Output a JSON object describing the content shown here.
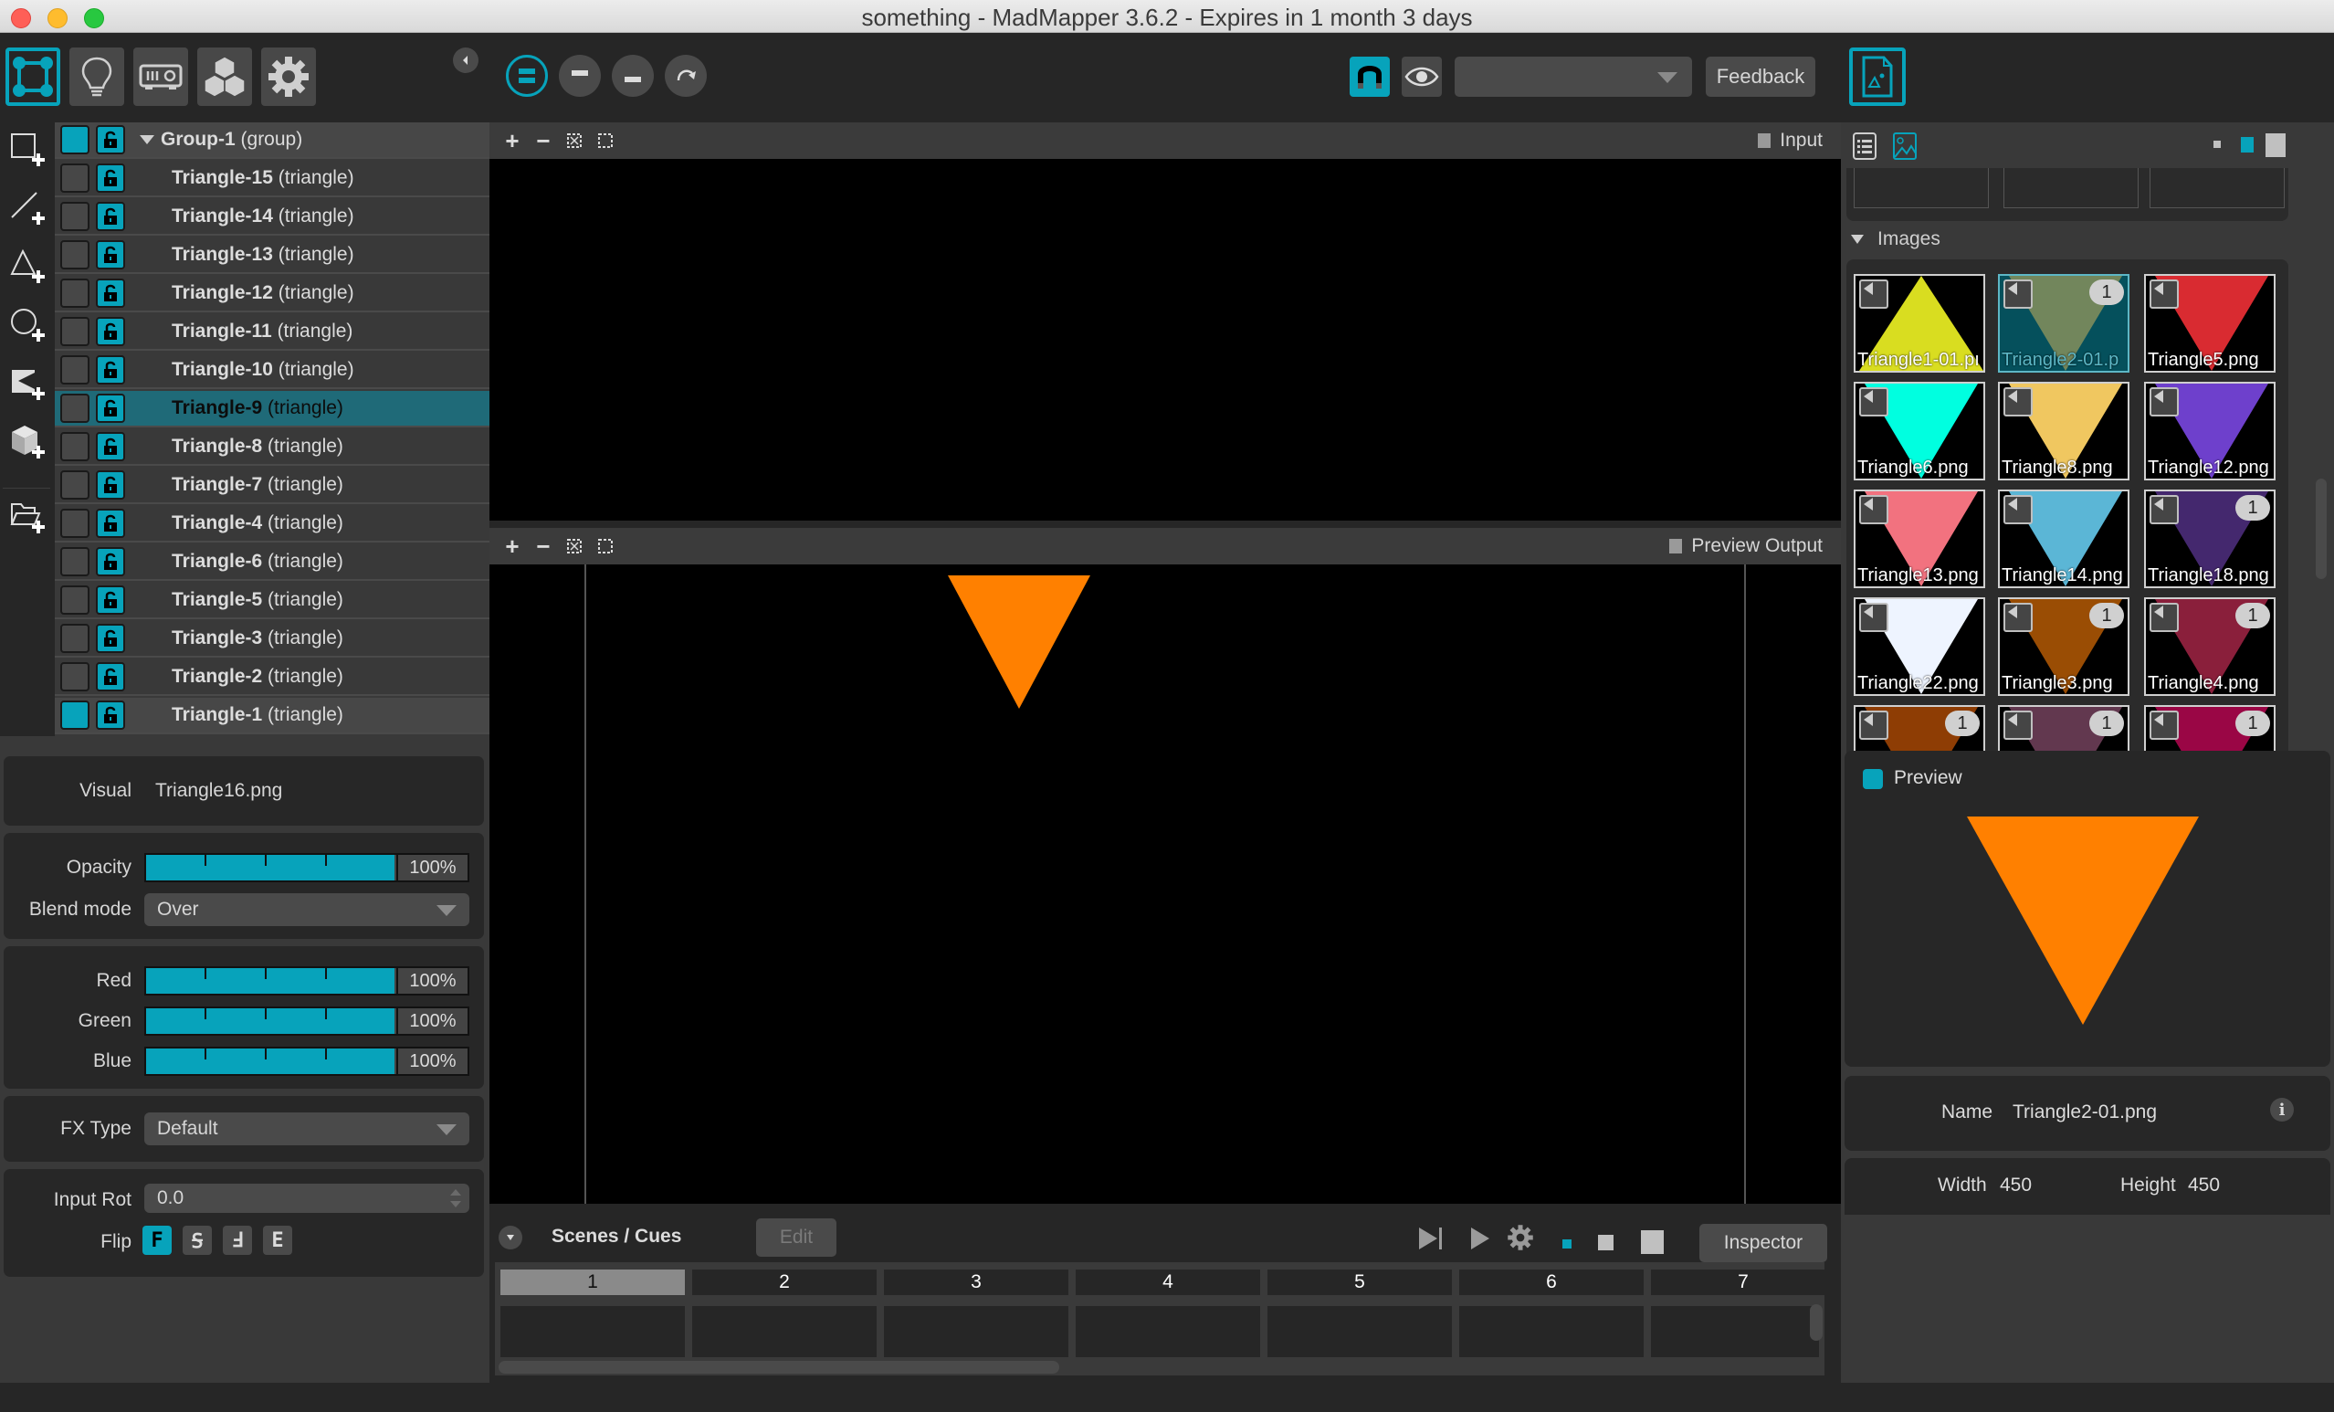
{
  "window": {
    "title": "something - MadMapper 3.6.2 - Expires in 1 month 3 days"
  },
  "colors": {
    "accent": "#07a3bb",
    "orange": "#ff8000",
    "selection_row": "#1f6a78"
  },
  "toolbar": {
    "modes": [
      {
        "name": "surfaces-mode",
        "icon": "surface-icon",
        "active": true
      },
      {
        "name": "lights-mode",
        "icon": "lightbulb-icon",
        "active": false
      },
      {
        "name": "output-mode",
        "icon": "projector-icon",
        "active": false
      },
      {
        "name": "modules-mode",
        "icon": "cubes-icon",
        "active": false
      },
      {
        "name": "settings-mode",
        "icon": "gear-icon",
        "active": false
      }
    ],
    "view_buttons": [
      "split-view",
      "top-view",
      "bottom-view",
      "rotate-view"
    ],
    "snap_label": "magnet-icon",
    "visibility_label": "eye-icon",
    "dropdown_value": "",
    "feedback_label": "Feedback"
  },
  "tools": [
    "add-quad",
    "add-line",
    "add-triangle",
    "add-circle",
    "add-mask",
    "add-3d-object",
    "add-group"
  ],
  "layers": {
    "group": {
      "name": "Group-1",
      "kind": "(group)",
      "visible": true
    },
    "items": [
      {
        "name": "Triangle-15",
        "kind": "(triangle)",
        "visible": false,
        "selected": false
      },
      {
        "name": "Triangle-14",
        "kind": "(triangle)",
        "visible": false,
        "selected": false
      },
      {
        "name": "Triangle-13",
        "kind": "(triangle)",
        "visible": false,
        "selected": false
      },
      {
        "name": "Triangle-12",
        "kind": "(triangle)",
        "visible": false,
        "selected": false
      },
      {
        "name": "Triangle-11",
        "kind": "(triangle)",
        "visible": false,
        "selected": false
      },
      {
        "name": "Triangle-10",
        "kind": "(triangle)",
        "visible": false,
        "selected": false
      },
      {
        "name": "Triangle-9",
        "kind": "(triangle)",
        "visible": false,
        "selected": true
      },
      {
        "name": "Triangle-8",
        "kind": "(triangle)",
        "visible": false,
        "selected": false
      },
      {
        "name": "Triangle-7",
        "kind": "(triangle)",
        "visible": false,
        "selected": false
      },
      {
        "name": "Triangle-4",
        "kind": "(triangle)",
        "visible": false,
        "selected": false
      },
      {
        "name": "Triangle-6",
        "kind": "(triangle)",
        "visible": false,
        "selected": false
      },
      {
        "name": "Triangle-5",
        "kind": "(triangle)",
        "visible": false,
        "selected": false
      },
      {
        "name": "Triangle-3",
        "kind": "(triangle)",
        "visible": false,
        "selected": false
      },
      {
        "name": "Triangle-2",
        "kind": "(triangle)",
        "visible": false,
        "selected": false
      },
      {
        "name": "Triangle-1",
        "kind": "(triangle)",
        "visible": true,
        "selected": false
      }
    ]
  },
  "properties": {
    "visual_label": "Visual",
    "visual_value": "Triangle16.png",
    "opacity_label": "Opacity",
    "opacity_value": "100%",
    "opacity_fraction": 1.0,
    "blend_label": "Blend mode",
    "blend_value": "Over",
    "red_label": "Red",
    "red_value": "100%",
    "green_label": "Green",
    "green_value": "100%",
    "blue_label": "Blue",
    "blue_value": "100%",
    "color_fraction": 1.0,
    "fx_label": "FX Type",
    "fx_value": "Default",
    "rot_label": "Input Rot",
    "rot_value": "0.0",
    "flip_label": "Flip",
    "flip_options": [
      "F",
      "Ꟊ",
      "Ⅎ",
      "E"
    ]
  },
  "viewports": {
    "input_label": "Input",
    "output_label": "Preview Output",
    "tools": [
      "+",
      "−",
      "fit",
      "select"
    ]
  },
  "scenes": {
    "title": "Scenes / Cues",
    "edit_label": "Edit",
    "inspector_label": "Inspector",
    "columns": [
      "1",
      "2",
      "3",
      "4",
      "5",
      "6",
      "7"
    ],
    "active_column": "1"
  },
  "media": {
    "section_title": "Images",
    "images": [
      {
        "name": "Triangle1-01.pı",
        "color": "#d9dd20",
        "up": true,
        "badge": "",
        "selected": false
      },
      {
        "name": "Triangle2-01.p",
        "color": "#7e8c5c",
        "up": false,
        "badge": "1",
        "selected": true
      },
      {
        "name": "Triangle5.png",
        "color": "#d92b31",
        "up": false,
        "badge": "",
        "selected": false
      },
      {
        "name": "Triangle6.png",
        "color": "#00ffe0",
        "up": false,
        "badge": "",
        "selected": false
      },
      {
        "name": "Triangle8.png",
        "color": "#f0c760",
        "up": false,
        "badge": "",
        "selected": false
      },
      {
        "name": "Triangle12.png",
        "color": "#6e40cc",
        "up": false,
        "badge": "",
        "selected": false
      },
      {
        "name": "Triangle13.png",
        "color": "#f2727f",
        "up": false,
        "badge": "",
        "selected": false
      },
      {
        "name": "Triangle14.png",
        "color": "#5bb6d6",
        "up": false,
        "badge": "",
        "selected": false
      },
      {
        "name": "Triangle18.png",
        "color": "#44286e",
        "up": false,
        "badge": "1",
        "selected": false
      },
      {
        "name": "Triangle22.png",
        "color": "#eef4ff",
        "up": false,
        "badge": "",
        "selected": false
      },
      {
        "name": "Triangle3.png",
        "color": "#9a4d04",
        "up": false,
        "badge": "1",
        "selected": false
      },
      {
        "name": "Triangle4.png",
        "color": "#8a1f3b",
        "up": false,
        "badge": "1",
        "selected": false
      },
      {
        "name": "",
        "color": "#8e3d04",
        "up": false,
        "badge": "1",
        "selected": false
      },
      {
        "name": "",
        "color": "#62384f",
        "up": false,
        "badge": "1",
        "selected": false
      },
      {
        "name": "",
        "color": "#9a0645",
        "up": false,
        "badge": "1",
        "selected": false
      }
    ],
    "preview_label": "Preview",
    "name_label": "Name",
    "name_value": "Triangle2-01.png",
    "width_label": "Width",
    "width_value": "450",
    "height_label": "Height",
    "height_value": "450"
  }
}
